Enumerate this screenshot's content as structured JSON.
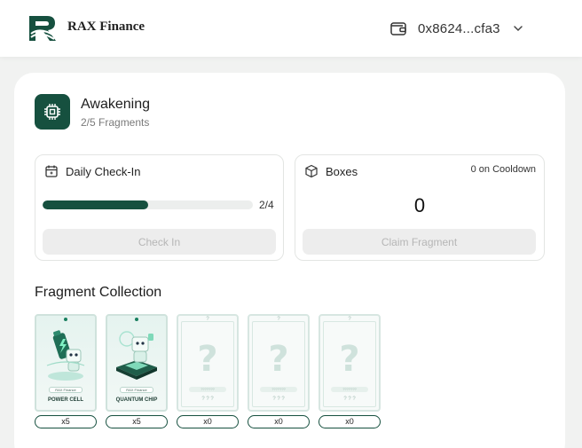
{
  "header": {
    "brand": "RAX Finance",
    "wallet_address": "0x8624...cfa3",
    "wallet_icon": "wallet-icon",
    "chevron_icon": "chevron-down-icon"
  },
  "awakening": {
    "title": "Awakening",
    "subtitle": "2/5 Fragments",
    "icon": "chip-icon"
  },
  "checkin": {
    "title": "Daily Check-In",
    "icon": "calendar-icon",
    "progress_label": "2/4",
    "progress_fraction": 0.5,
    "button_label": "Check In"
  },
  "boxes": {
    "title": "Boxes",
    "icon": "box-icon",
    "cooldown_label": "0 on Cooldown",
    "count": "0",
    "button_label": "Claim Fragment"
  },
  "collection": {
    "title": "Fragment Collection",
    "fragments": [
      {
        "name": "POWER CELL",
        "badge": "RAX Finance",
        "count": "x5",
        "owned": true,
        "art": "power-cell"
      },
      {
        "name": "QUANTUM CHIP",
        "badge": "RAX Finance",
        "count": "x5",
        "owned": true,
        "art": "quantum-chip"
      },
      {
        "name": "? ? ?",
        "badge": "???????",
        "count": "x0",
        "owned": false,
        "mark": "?"
      },
      {
        "name": "? ? ?",
        "badge": "???????",
        "count": "x0",
        "owned": false,
        "mark": "?"
      },
      {
        "name": "? ? ?",
        "badge": "???????",
        "count": "x0",
        "owned": false,
        "mark": "?"
      }
    ]
  },
  "colors": {
    "accent": "#16503f",
    "background": "#f1f2f1",
    "card": "#ffffff",
    "disabled": "#ededed"
  }
}
